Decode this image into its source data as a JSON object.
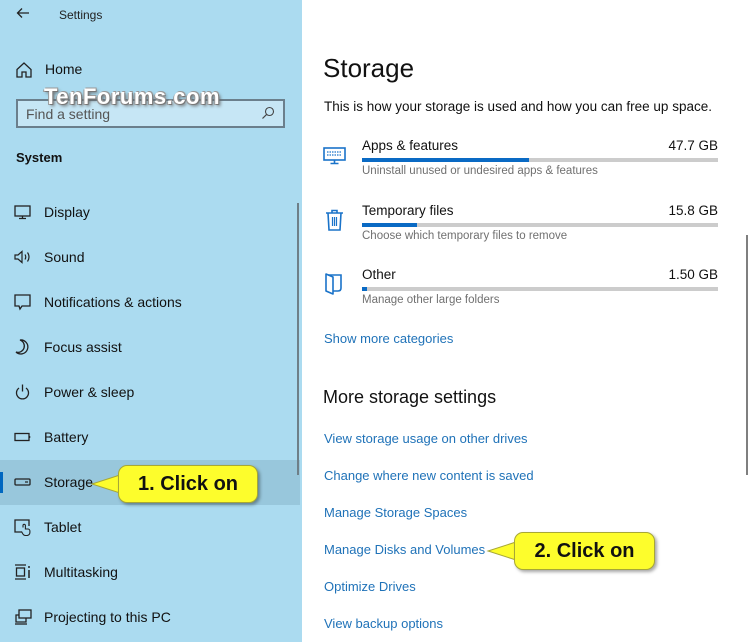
{
  "window": {
    "title": "Settings",
    "back_icon": "back-arrow-icon"
  },
  "watermark": "TenForums.com",
  "sidebar": {
    "home_label": "Home",
    "search_placeholder": "Find a setting",
    "section_title": "System",
    "items": [
      {
        "label": "Display",
        "icon": "display-icon",
        "selected": false
      },
      {
        "label": "Sound",
        "icon": "speaker-icon",
        "selected": false
      },
      {
        "label": "Notifications & actions",
        "icon": "notification-icon",
        "selected": false
      },
      {
        "label": "Focus assist",
        "icon": "moon-icon",
        "selected": false
      },
      {
        "label": "Power & sleep",
        "icon": "power-icon",
        "selected": false
      },
      {
        "label": "Battery",
        "icon": "battery-icon",
        "selected": false
      },
      {
        "label": "Storage",
        "icon": "storage-drive-icon",
        "selected": true
      },
      {
        "label": "Tablet",
        "icon": "tablet-icon",
        "selected": false
      },
      {
        "label": "Multitasking",
        "icon": "multitasking-icon",
        "selected": false
      },
      {
        "label": "Projecting to this PC",
        "icon": "projecting-icon",
        "selected": false
      }
    ]
  },
  "main": {
    "title": "Storage",
    "description": "This is how your storage is used and how you can free up space.",
    "categories": [
      {
        "name": "Apps & features",
        "size": "47.7 GB",
        "usage_fraction": 0.47,
        "description": "Uninstall unused or undesired apps & features",
        "icon": "apps-keyboard-icon"
      },
      {
        "name": "Temporary files",
        "size": "15.8 GB",
        "usage_fraction": 0.155,
        "description": "Choose which temporary files to remove",
        "icon": "trash-icon"
      },
      {
        "name": "Other",
        "size": "1.50 GB",
        "usage_fraction": 0.015,
        "description": "Manage other large folders",
        "icon": "folder-icon"
      }
    ],
    "show_more_label": "Show more categories",
    "more_settings_title": "More storage settings",
    "more_links": [
      "View storage usage on other drives",
      "Change where new content is saved",
      "Manage Storage Spaces",
      "Manage Disks and Volumes",
      "Optimize Drives",
      "View backup options"
    ]
  },
  "callouts": [
    {
      "text": "1. Click on",
      "target": "Storage"
    },
    {
      "text": "2. Click on",
      "target": "Manage Disks and Volumes"
    }
  ],
  "colors": {
    "sidebar_bg": "#abdbf0",
    "selected_bg": "#98c7dc",
    "accent": "#0a6ac4",
    "link": "#1f72b8",
    "callout": "#fdfd2c"
  }
}
